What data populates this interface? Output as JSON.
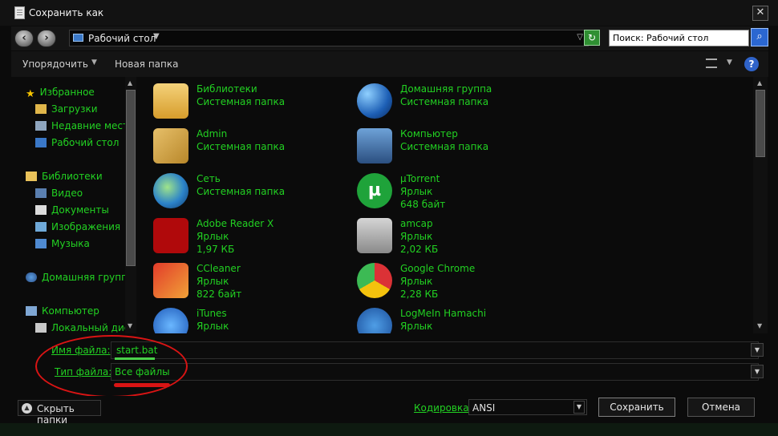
{
  "window": {
    "title": "Сохранить как",
    "close": "✕"
  },
  "nav": {
    "address": "Рабочий стол",
    "search_placeholder": "Поиск: Рабочий стол",
    "back_icon": "‹",
    "forward_icon": "›",
    "refresh_icon": "↻",
    "search_icon": "⌕",
    "address_drop": "▼",
    "history_drop": "▽"
  },
  "toolbar": {
    "organize": "Упорядочить",
    "new_folder": "Новая папка",
    "organize_drop": "▼",
    "view_drop": "▼",
    "help": "?"
  },
  "sidebar": {
    "favorites": "Избранное",
    "downloads": "Загрузки",
    "recent": "Недавние места",
    "desktop": "Рабочий стол",
    "libraries": "Библиотеки",
    "video": "Видео",
    "documents": "Документы",
    "images": "Изображения",
    "music": "Музыка",
    "homegroup": "Домашняя группа",
    "computer": "Компьютер",
    "local_disk": "Локальный диск"
  },
  "files": [
    {
      "name": "Библиотеки",
      "meta1": "Системная папка",
      "meta2": ""
    },
    {
      "name": "Домашняя группа",
      "meta1": "Системная папка",
      "meta2": ""
    },
    {
      "name": "Admin",
      "meta1": "Системная папка",
      "meta2": ""
    },
    {
      "name": "Компьютер",
      "meta1": "Системная папка",
      "meta2": ""
    },
    {
      "name": "Сеть",
      "meta1": "Системная папка",
      "meta2": ""
    },
    {
      "name": "µTorrent",
      "meta1": "Ярлык",
      "meta2": "648 байт"
    },
    {
      "name": "Adobe Reader X",
      "meta1": "Ярлык",
      "meta2": "1,97 КБ"
    },
    {
      "name": "amcap",
      "meta1": "Ярлык",
      "meta2": "2,02 КБ"
    },
    {
      "name": "CCleaner",
      "meta1": "Ярлык",
      "meta2": "822 байт"
    },
    {
      "name": "Google Chrome",
      "meta1": "Ярлык",
      "meta2": "2,28 КБ"
    },
    {
      "name": "iTunes",
      "meta1": "Ярлык",
      "meta2": ""
    },
    {
      "name": "LogMeIn Hamachi",
      "meta1": "Ярлык",
      "meta2": ""
    }
  ],
  "form": {
    "filename_label": "Имя файла:",
    "filename_value": "start.bat",
    "filetype_label": "Тип файла:",
    "filetype_value": "Все файлы",
    "drop": "▼"
  },
  "bottom": {
    "hide_folders": "Скрыть папки",
    "hide_icon": "▲",
    "encoding_label": "Кодировка:",
    "encoding_value": "ANSI",
    "encoding_drop": "▼",
    "save": "Сохранить",
    "cancel": "Отмена"
  },
  "colors": {
    "accent_green": "#22d122",
    "annotation_red": "#d91414",
    "background": "#0b0b0b"
  }
}
